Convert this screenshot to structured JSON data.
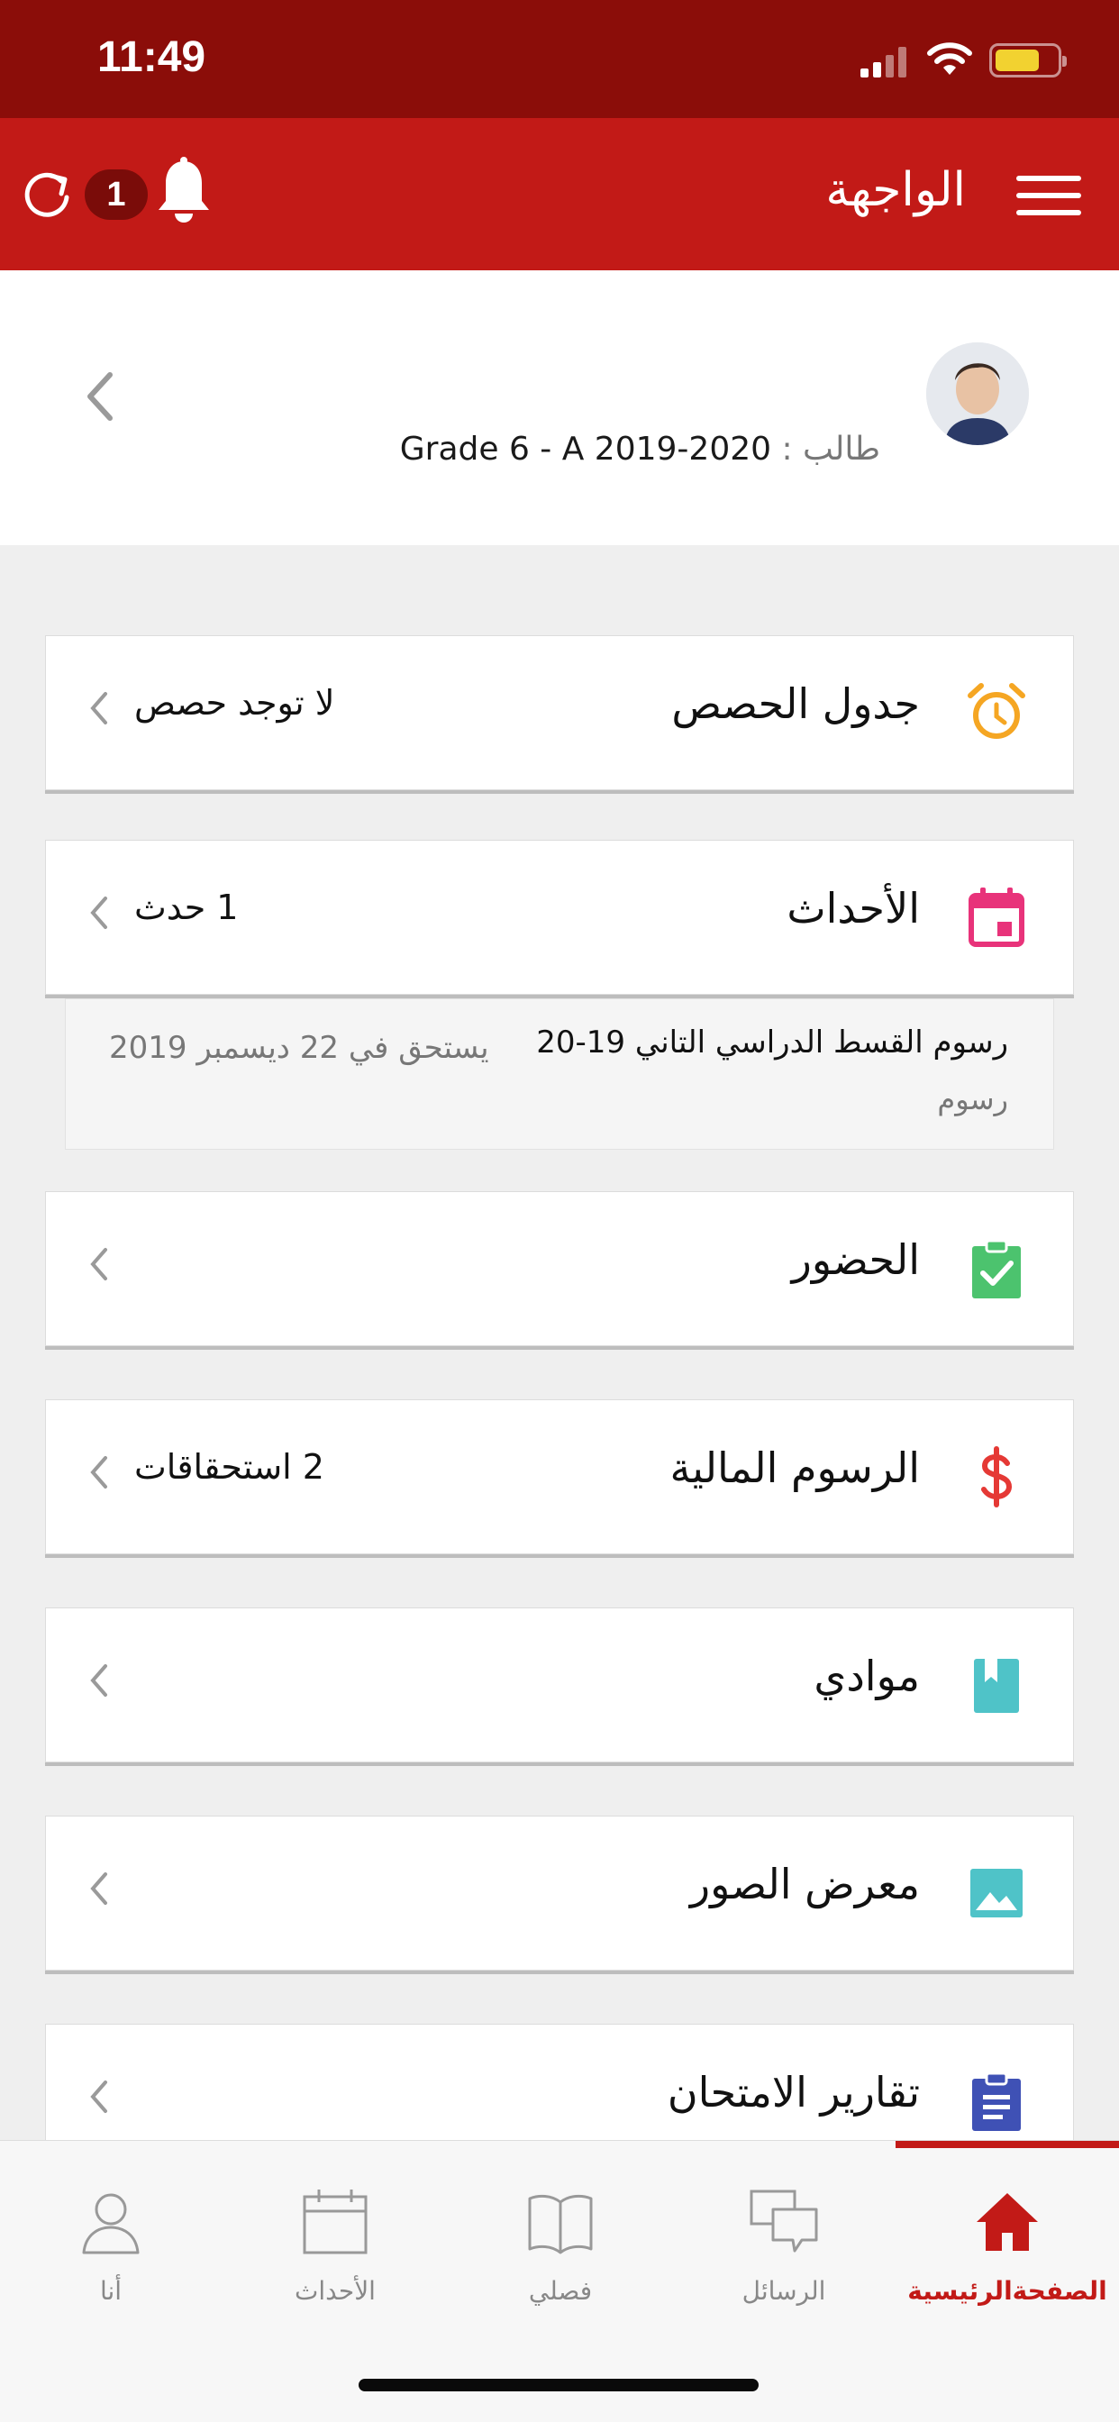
{
  "status_bar": {
    "time": "11:49"
  },
  "header": {
    "title": "الواجهة",
    "notification_count": "1"
  },
  "profile": {
    "label": "طالب :",
    "grade": "Grade 6 - A 2019-2020"
  },
  "cards": [
    {
      "title": "جدول الحصص",
      "value": "لا توجد حصص",
      "icon": "alarm-clock-icon",
      "color": "#f5a623"
    },
    {
      "title": "الأحداث",
      "value": "1 حدث",
      "icon": "calendar-icon",
      "color": "#e8337a"
    },
    {
      "title": "الحضور",
      "value": "",
      "icon": "clipboard-check-icon",
      "color": "#4cc36e"
    },
    {
      "title": "الرسوم المالية",
      "value": "2 استحقاقات",
      "icon": "dollar-icon",
      "color": "#e53935"
    },
    {
      "title": "موادي",
      "value": "",
      "icon": "book-icon",
      "color": "#4fc3c8"
    },
    {
      "title": "معرض الصور",
      "value": "",
      "icon": "image-icon",
      "color": "#4fc3c8"
    },
    {
      "title": "تقارير الامتحان",
      "value": "",
      "icon": "clipboard-list-icon",
      "color": "#3f51b5"
    }
  ],
  "event": {
    "title": "رسوم القسط الدراسي التاني 19-20",
    "category": "رسوم",
    "due": "يستحق في 22 ديسمبر 2019"
  },
  "tabs": [
    {
      "label": "الصفحةالرئيسية",
      "icon": "home-icon",
      "active": true
    },
    {
      "label": "الرسائل",
      "icon": "messages-icon",
      "active": false
    },
    {
      "label": "فصلي",
      "icon": "book-open-icon",
      "active": false
    },
    {
      "label": "الأحداث",
      "icon": "calendar-icon",
      "active": false
    },
    {
      "label": "أنا",
      "icon": "user-icon",
      "active": false
    }
  ],
  "colors": {
    "status_bar": "#8b0d09",
    "header": "#c21a17",
    "accent": "#c21a17",
    "background": "#efefef"
  }
}
